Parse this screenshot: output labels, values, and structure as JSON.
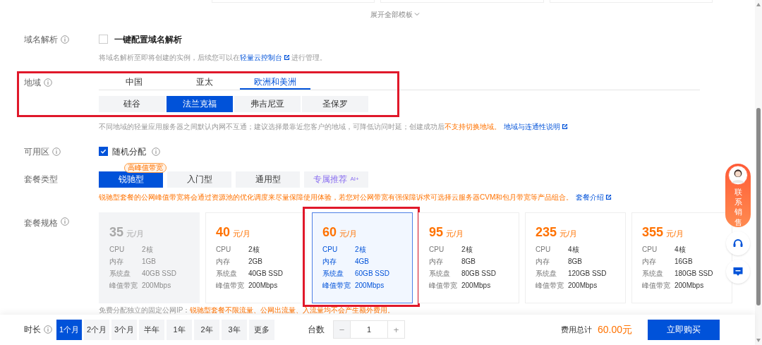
{
  "template_toggle": {
    "label": "展开全部模板"
  },
  "domain": {
    "label": "域名解析",
    "checkbox": {
      "label": "一键配置域名解析",
      "checked": false
    },
    "hint": "将域名解析至即将创建的实例，后续您可以在",
    "hint_link": "轻量云控制台",
    "hint_end": "进行管理。"
  },
  "region": {
    "label": "地域",
    "tabs": [
      {
        "label": "中国",
        "selected": false
      },
      {
        "label": "亚太",
        "selected": false
      },
      {
        "label": "欧洲和美洲",
        "selected": true
      }
    ],
    "cities": [
      {
        "label": "硅谷",
        "selected": false
      },
      {
        "label": "法兰克福",
        "selected": true
      },
      {
        "label": "弗吉尼亚",
        "selected": false
      },
      {
        "label": "圣保罗",
        "selected": false
      }
    ],
    "note": "不同地域的轻量应用服务器之间默认内网不互通；建议选择最靠近您客户的地域，可降低访问时延；创建成功后",
    "note_warning": "不支持切换地域。",
    "note_link": "地域与连通性说明"
  },
  "zone": {
    "label": "可用区",
    "checkbox": {
      "label": "随机分配",
      "checked": true
    }
  },
  "plan_type": {
    "label": "套餐类型",
    "options": [
      {
        "kind": "plain",
        "label": "锐驰型",
        "selected": true,
        "badge": "高峰值带宽"
      },
      {
        "kind": "plain",
        "label": "入门型",
        "selected": false
      },
      {
        "kind": "plain",
        "label": "通用型",
        "selected": false
      },
      {
        "kind": "ai",
        "label": "专属推荐",
        "tag": "AI+",
        "selected": false
      }
    ],
    "note": "锐驰型套餐的公网峰值带宽将会通过资源池的优化调度来尽量保障使用体验，若您对公网带宽有强保障诉求可选择云服务器CVM和包月带宽等产品组合。",
    "note_link": "套餐介绍"
  },
  "plan_spec": {
    "label": "套餐规格",
    "cards": [
      {
        "price": "35",
        "unit": "元/月",
        "disabled": true,
        "selected": false,
        "specs": [
          {
            "name": "CPU",
            "value": "2核"
          },
          {
            "name": "内存",
            "value": "1GB"
          },
          {
            "name": "系统盘",
            "value": "40GB SSD"
          },
          {
            "name": "峰值带宽",
            "value": "200Mbps"
          }
        ]
      },
      {
        "price": "40",
        "unit": "元/月",
        "disabled": false,
        "selected": false,
        "specs": [
          {
            "name": "CPU",
            "value": "2核"
          },
          {
            "name": "内存",
            "value": "2GB"
          },
          {
            "name": "系统盘",
            "value": "40GB SSD"
          },
          {
            "name": "峰值带宽",
            "value": "200Mbps"
          }
        ]
      },
      {
        "price": "60",
        "unit": "元/月",
        "disabled": false,
        "selected": true,
        "specs": [
          {
            "name": "CPU",
            "value": "2核"
          },
          {
            "name": "内存",
            "value": "4GB"
          },
          {
            "name": "系统盘",
            "value": "60GB SSD"
          },
          {
            "name": "峰值带宽",
            "value": "200Mbps"
          }
        ]
      },
      {
        "price": "95",
        "unit": "元/月",
        "disabled": false,
        "selected": false,
        "specs": [
          {
            "name": "CPU",
            "value": "2核"
          },
          {
            "name": "内存",
            "value": "8GB"
          },
          {
            "name": "系统盘",
            "value": "80GB SSD"
          },
          {
            "name": "峰值带宽",
            "value": "200Mbps"
          }
        ]
      },
      {
        "price": "235",
        "unit": "元/月",
        "disabled": false,
        "selected": false,
        "specs": [
          {
            "name": "CPU",
            "value": "4核"
          },
          {
            "name": "内存",
            "value": "8GB"
          },
          {
            "name": "系统盘",
            "value": "120GB SSD"
          },
          {
            "name": "峰值带宽",
            "value": "200Mbps"
          }
        ]
      },
      {
        "price": "355",
        "unit": "元/月",
        "disabled": false,
        "selected": false,
        "specs": [
          {
            "name": "CPU",
            "value": "4核"
          },
          {
            "name": "内存",
            "value": "16GB"
          },
          {
            "name": "系统盘",
            "value": "180GB SSD"
          },
          {
            "name": "峰值带宽",
            "value": "200Mbps"
          }
        ]
      }
    ],
    "footnote": "免费分配独立的固定公网IP：",
    "footnote_warning": "锐驰型套餐不限流量、公网出流量、入流量均不会产生额外费用。"
  },
  "footer": {
    "duration": {
      "label": "时长",
      "options": [
        {
          "label": "1个月",
          "selected": true
        },
        {
          "label": "2个月",
          "selected": false
        },
        {
          "label": "3个月",
          "selected": false
        },
        {
          "label": "半年",
          "selected": false
        },
        {
          "label": "1年",
          "selected": false
        },
        {
          "label": "2年",
          "selected": false
        },
        {
          "label": "3年",
          "selected": false
        },
        {
          "label": "更多",
          "selected": false
        }
      ]
    },
    "quantity": {
      "label": "台数",
      "decrement": "−",
      "value": "1",
      "increment": "+"
    },
    "total": {
      "label": "费用总计",
      "amount": "60.00元"
    },
    "buy_button": "立即购买"
  },
  "contact": {
    "label": "联系销售"
  }
}
